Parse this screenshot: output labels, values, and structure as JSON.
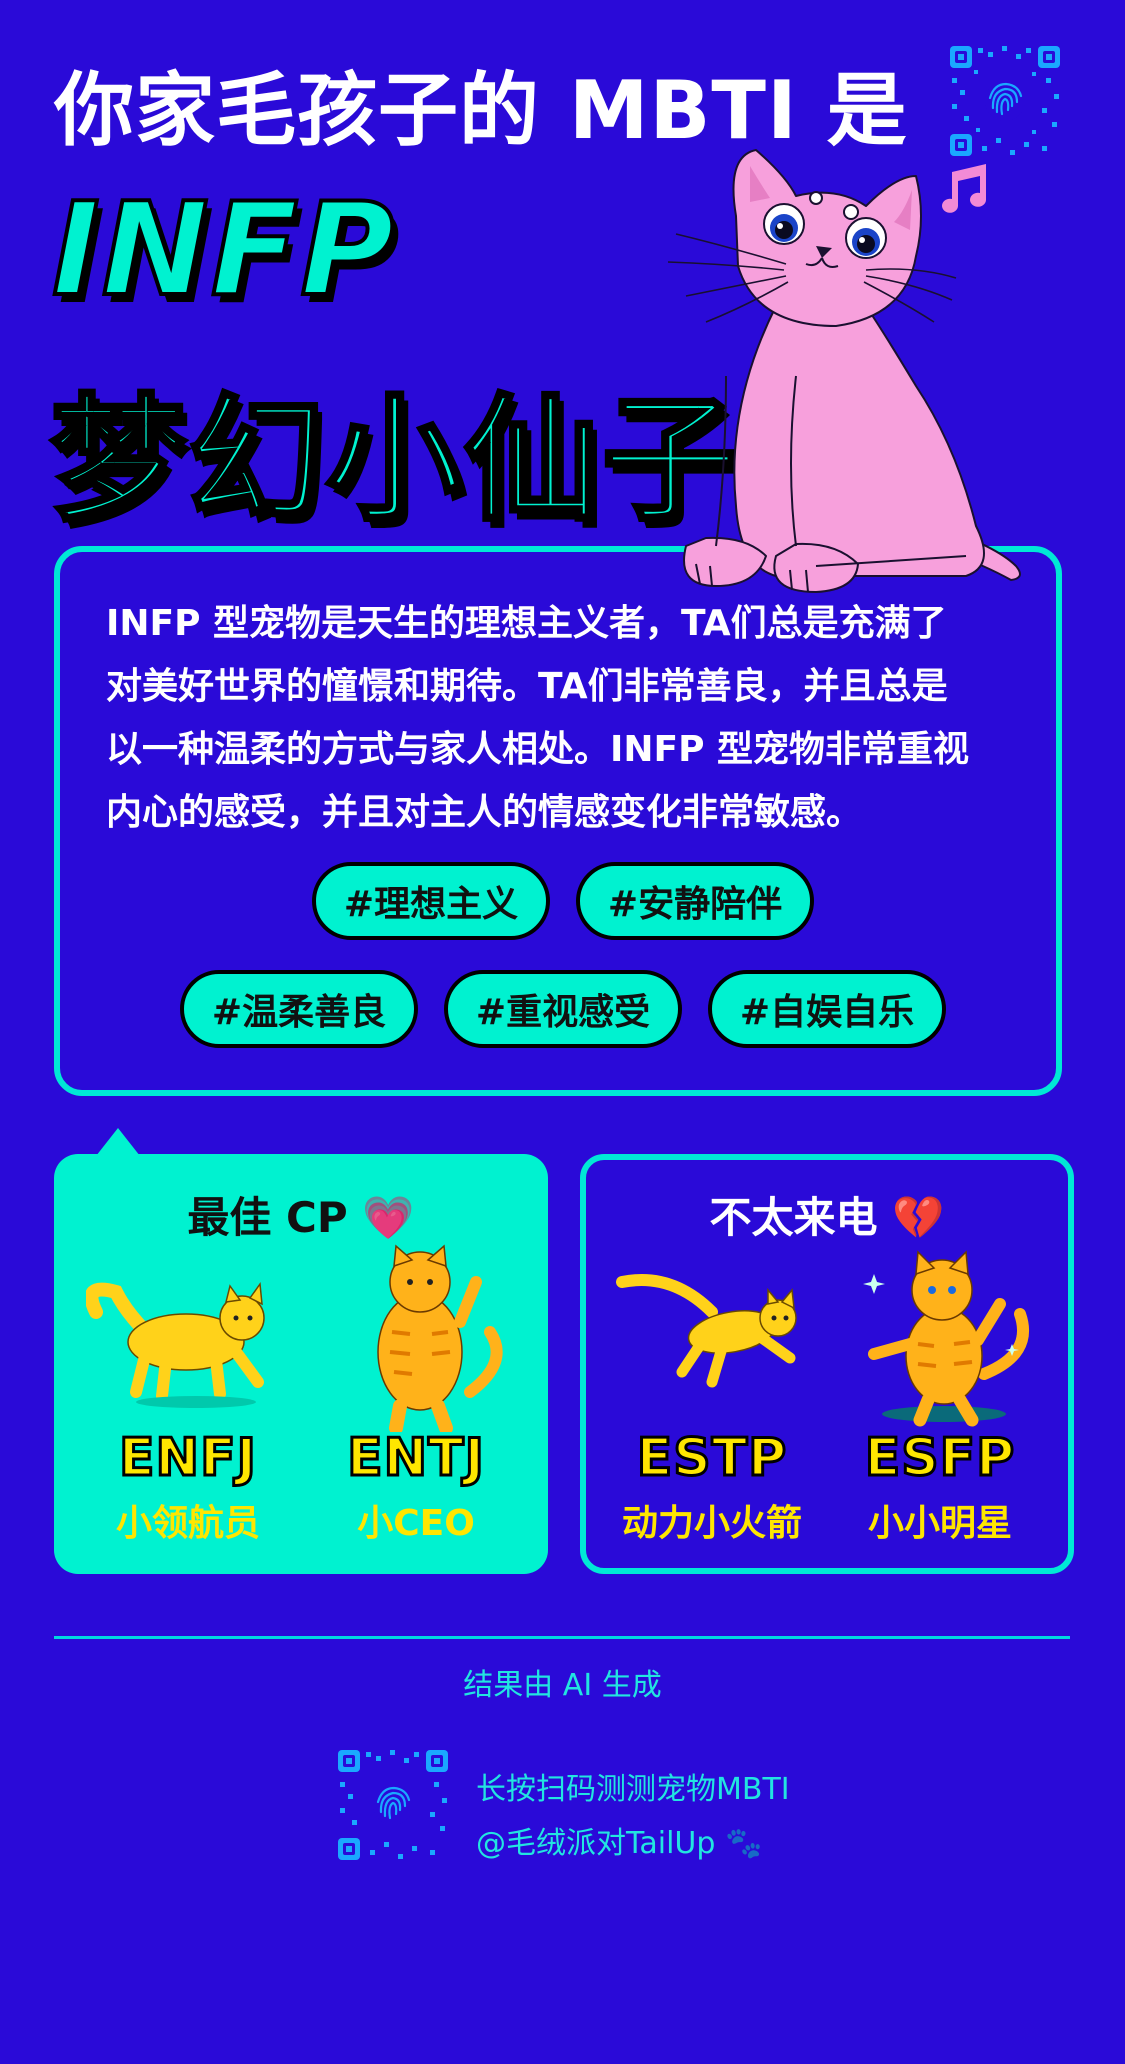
{
  "header": {
    "headline": "你家毛孩子的 MBTI 是",
    "type_code": "INFP",
    "nickname": "梦幻小仙子"
  },
  "description": {
    "lines": [
      "INFP 型宠物是天生的理想主义者，TA们总是充满了",
      "对美好世界的憧憬和期待。TA们非常善良，并且总是",
      "以一种温柔的方式与家人相处。INFP 型宠物非常重视",
      "内心的感受，并且对主人的情感变化非常敏感。"
    ],
    "tags": [
      "#理想主义",
      "#安静陪伴",
      "#温柔善良",
      "#重视感受",
      "#自娱自乐"
    ]
  },
  "best_match": {
    "title": "最佳 CP 💗",
    "pets": [
      {
        "code": "ENFJ",
        "nickname": "小领航员",
        "icon": "yellow-cat-walking-icon"
      },
      {
        "code": "ENTJ",
        "nickname": "小CEO",
        "icon": "orange-cat-standing-icon"
      }
    ]
  },
  "worst_match": {
    "title": "不太来电 💔",
    "pets": [
      {
        "code": "ESTP",
        "nickname": "动力小火箭",
        "icon": "yellow-cat-leaping-icon"
      },
      {
        "code": "ESFP",
        "nickname": "小小明星",
        "icon": "orange-cat-dancing-icon"
      }
    ]
  },
  "footer": {
    "ai_note": "结果由 AI 生成",
    "scan_prompt": "长按扫码测测宠物MBTI",
    "handle": "@毛绒派对TailUp 🐾"
  },
  "colors": {
    "background": "#2a0ad8",
    "accent": "#00f2d0",
    "yellow": "#ffe600",
    "cat_pink": "#f7a0dc"
  }
}
